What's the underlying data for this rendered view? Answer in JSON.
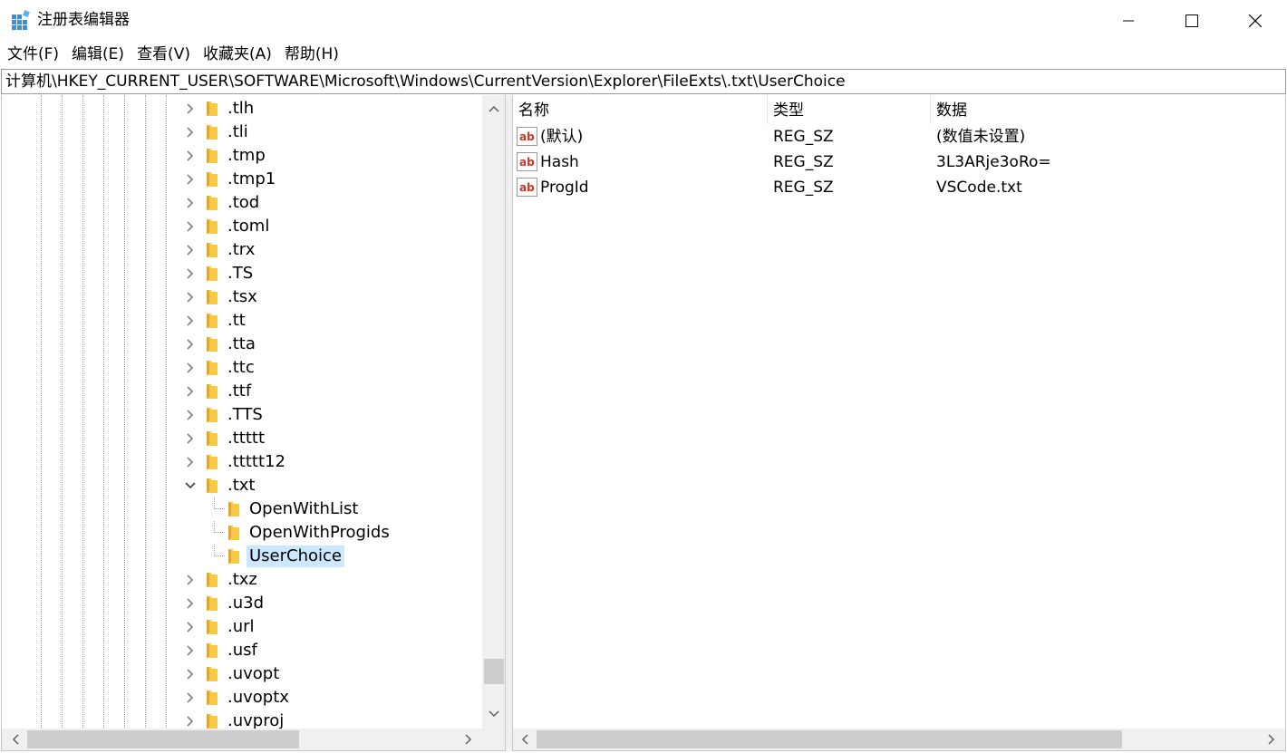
{
  "window": {
    "title": "注册表编辑器",
    "icon": "regedit-icon"
  },
  "menu": [
    "文件(F)",
    "编辑(E)",
    "查看(V)",
    "收藏夹(A)",
    "帮助(H)"
  ],
  "address": "计算机\\HKEY_CURRENT_USER\\SOFTWARE\\Microsoft\\Windows\\CurrentVersion\\Explorer\\FileExts\\.txt\\UserChoice",
  "tree": [
    {
      "label": ".tlh",
      "depth": 0,
      "state": "collapsed"
    },
    {
      "label": ".tli",
      "depth": 0,
      "state": "collapsed"
    },
    {
      "label": ".tmp",
      "depth": 0,
      "state": "collapsed"
    },
    {
      "label": ".tmp1",
      "depth": 0,
      "state": "collapsed"
    },
    {
      "label": ".tod",
      "depth": 0,
      "state": "collapsed"
    },
    {
      "label": ".toml",
      "depth": 0,
      "state": "collapsed"
    },
    {
      "label": ".trx",
      "depth": 0,
      "state": "collapsed"
    },
    {
      "label": ".TS",
      "depth": 0,
      "state": "collapsed"
    },
    {
      "label": ".tsx",
      "depth": 0,
      "state": "collapsed"
    },
    {
      "label": ".tt",
      "depth": 0,
      "state": "collapsed"
    },
    {
      "label": ".tta",
      "depth": 0,
      "state": "collapsed"
    },
    {
      "label": ".ttc",
      "depth": 0,
      "state": "collapsed"
    },
    {
      "label": ".ttf",
      "depth": 0,
      "state": "collapsed"
    },
    {
      "label": ".TTS",
      "depth": 0,
      "state": "collapsed"
    },
    {
      "label": ".ttttt",
      "depth": 0,
      "state": "collapsed"
    },
    {
      "label": ".ttttt12",
      "depth": 0,
      "state": "collapsed"
    },
    {
      "label": ".txt",
      "depth": 0,
      "state": "expanded"
    },
    {
      "label": "OpenWithList",
      "depth": 1,
      "state": "leaf"
    },
    {
      "label": "OpenWithProgids",
      "depth": 1,
      "state": "leaf"
    },
    {
      "label": "UserChoice",
      "depth": 1,
      "state": "leaf",
      "selected": true
    },
    {
      "label": ".txz",
      "depth": 0,
      "state": "collapsed"
    },
    {
      "label": ".u3d",
      "depth": 0,
      "state": "collapsed"
    },
    {
      "label": ".url",
      "depth": 0,
      "state": "collapsed"
    },
    {
      "label": ".usf",
      "depth": 0,
      "state": "collapsed"
    },
    {
      "label": ".uvopt",
      "depth": 0,
      "state": "collapsed"
    },
    {
      "label": ".uvoptx",
      "depth": 0,
      "state": "collapsed"
    },
    {
      "label": ".uvproj",
      "depth": 0,
      "state": "collapsed"
    }
  ],
  "list": {
    "columns": {
      "name": "名称",
      "type": "类型",
      "data": "数据"
    },
    "rows": [
      {
        "name": "(默认)",
        "type": "REG_SZ",
        "data": "(数值未设置)",
        "icon": "string-value-icon"
      },
      {
        "name": "Hash",
        "type": "REG_SZ",
        "data": "3L3ARje3oRo=",
        "icon": "string-value-icon"
      },
      {
        "name": "ProgId",
        "type": "REG_SZ",
        "data": "VSCode.txt",
        "icon": "string-value-icon"
      }
    ]
  },
  "colors": {
    "selection": "#cce8ff",
    "folder": "#f6c94a",
    "value_icon_red": "#c0392b"
  }
}
